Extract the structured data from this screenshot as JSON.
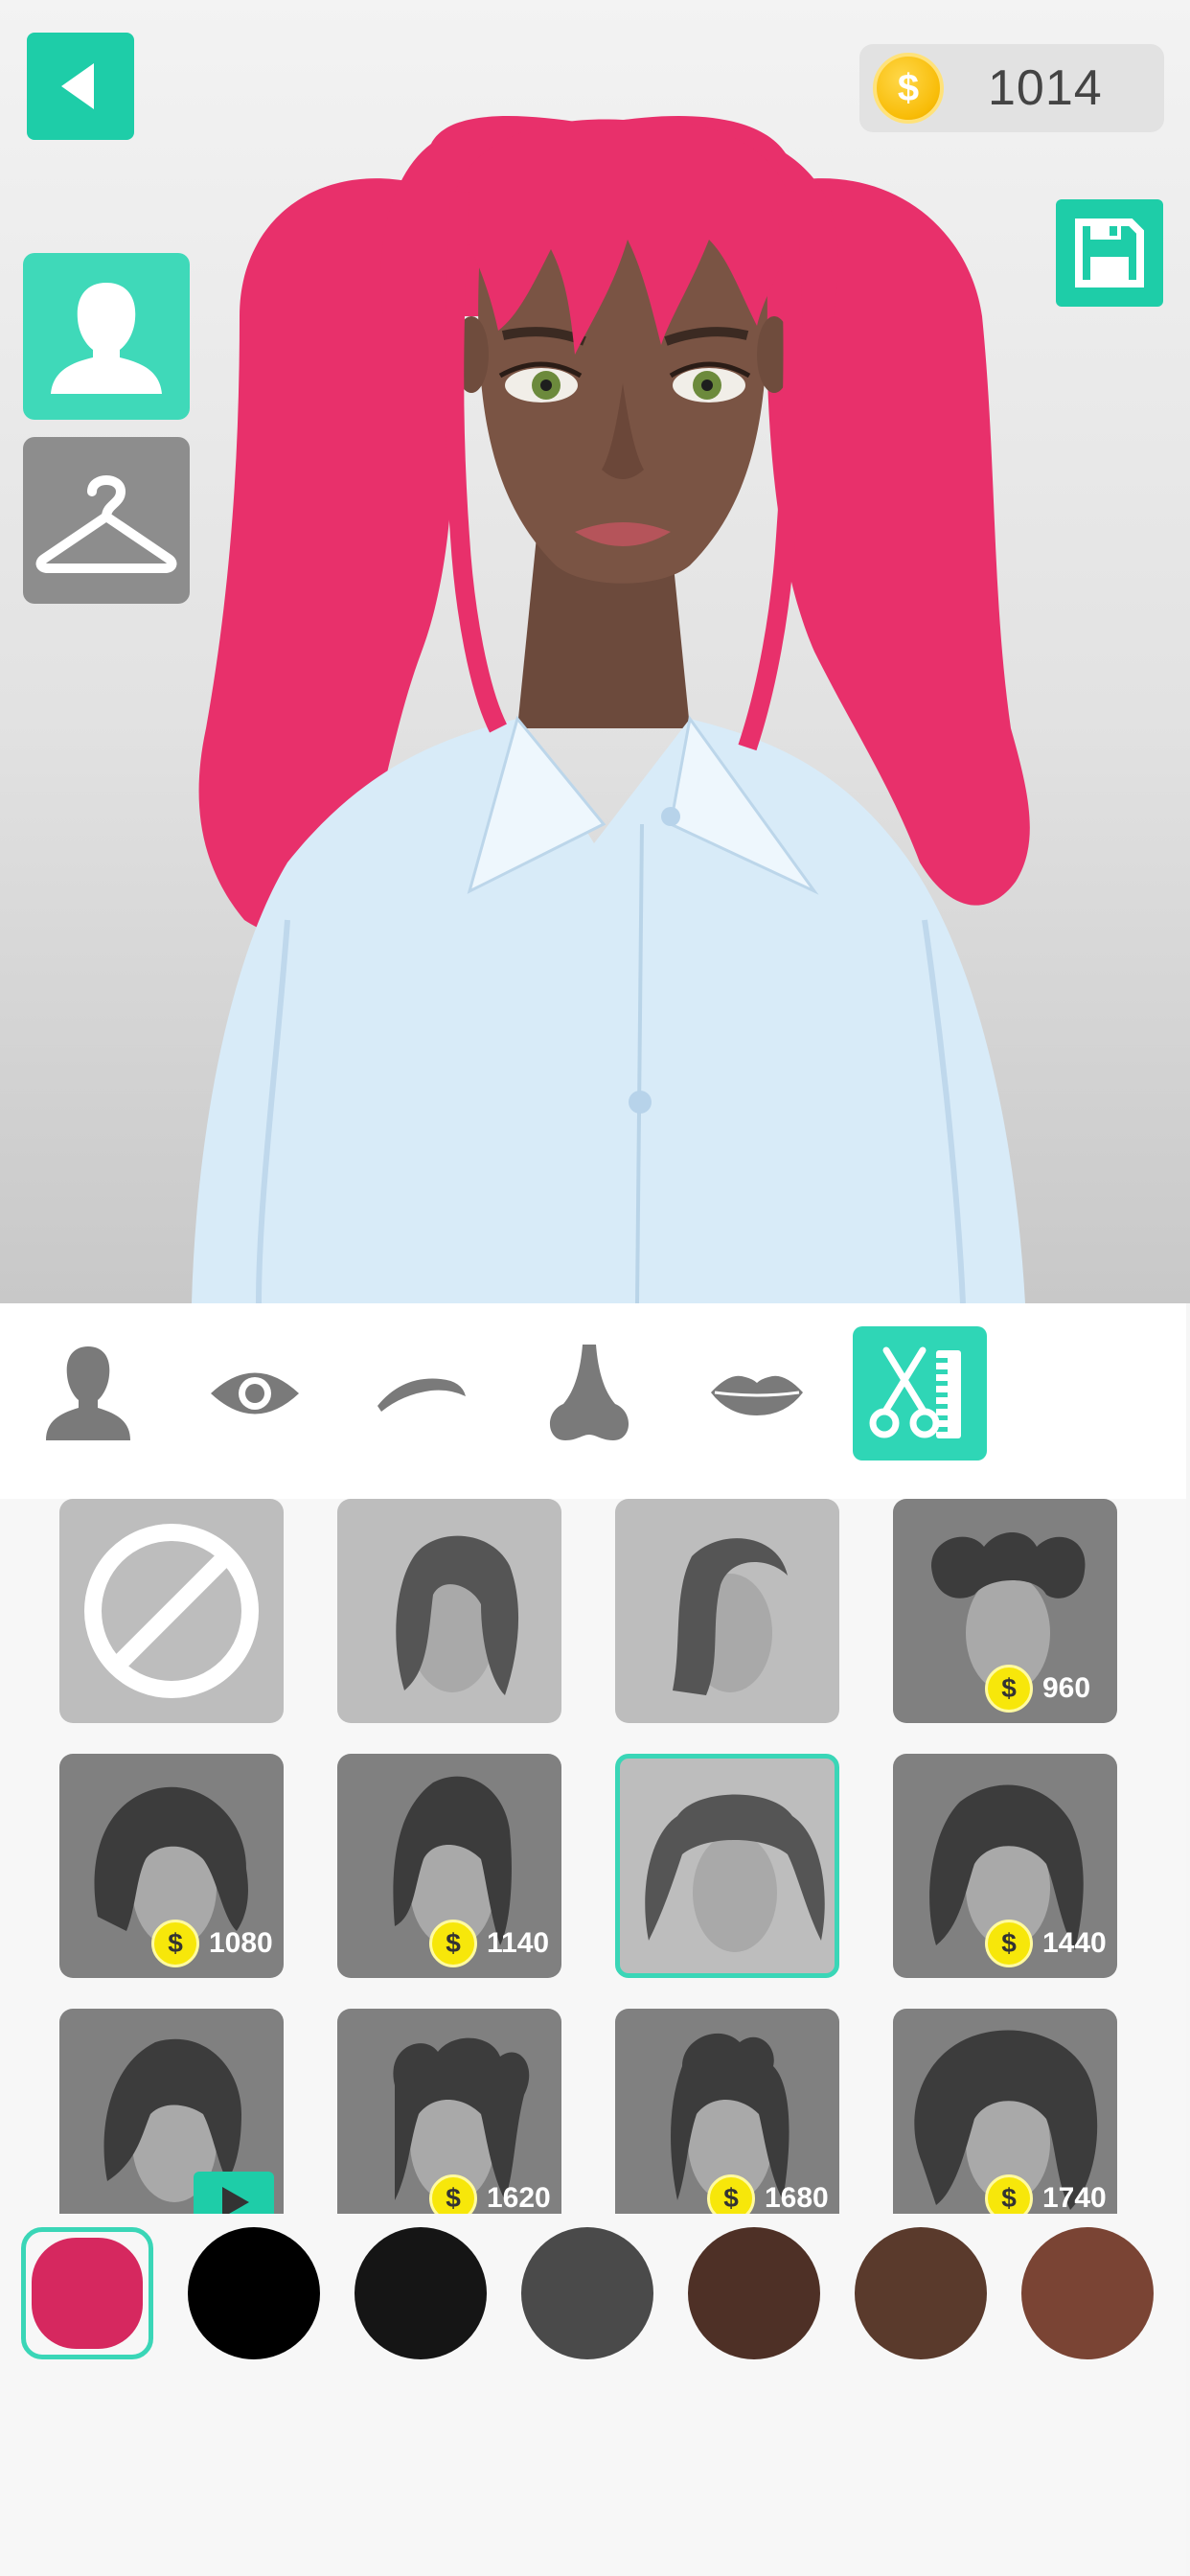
{
  "app": {
    "screen": "avatar-editor-hair"
  },
  "header": {
    "back_icon": "back-arrow-icon",
    "coins": "1014",
    "coin_icon": "dollar-coin-icon",
    "save_icon": "floppy-disk-icon"
  },
  "modes": [
    {
      "name": "avatar",
      "icon": "person-icon",
      "active": true
    },
    {
      "name": "clothes",
      "icon": "hanger-icon",
      "active": false
    }
  ],
  "categories": [
    {
      "name": "face",
      "icon": "person-silhouette-icon",
      "active": false
    },
    {
      "name": "eyes",
      "icon": "eye-icon",
      "active": false
    },
    {
      "name": "eyebrows",
      "icon": "eyebrow-icon",
      "active": false
    },
    {
      "name": "nose",
      "icon": "nose-icon",
      "active": false
    },
    {
      "name": "lips",
      "icon": "lips-icon",
      "active": false
    },
    {
      "name": "hair",
      "icon": "scissors-comb-icon",
      "active": true
    }
  ],
  "hair_styles": [
    {
      "id": "none",
      "icon": "no-sign-icon",
      "price": null
    },
    {
      "id": "long-wavy",
      "price": null
    },
    {
      "id": "side-wave",
      "price": null
    },
    {
      "id": "double-buns",
      "price": "960"
    },
    {
      "id": "curly-bob",
      "price": "1080"
    },
    {
      "id": "high-ponytail",
      "price": "1140"
    },
    {
      "id": "pigtails",
      "price": null,
      "selected": true
    },
    {
      "id": "long-curly",
      "price": "1440"
    },
    {
      "id": "bangs-bob",
      "price": null,
      "video": true
    },
    {
      "id": "space-buns",
      "price": "1620"
    },
    {
      "id": "top-bun",
      "price": "1680"
    },
    {
      "id": "afro-curls",
      "price": "1740"
    }
  ],
  "hair_colors": [
    {
      "hex": "#d6285f",
      "selected": true
    },
    {
      "hex": "#000000"
    },
    {
      "hex": "#151515"
    },
    {
      "hex": "#4a4a4a"
    },
    {
      "hex": "#4e3026"
    },
    {
      "hex": "#5a3a2c"
    },
    {
      "hex": "#7a4434"
    }
  ],
  "colors": {
    "accent": "#1ecda8",
    "hair": "#e8306b",
    "skin": "#7a5444",
    "shirt": "#d9ecf8"
  }
}
